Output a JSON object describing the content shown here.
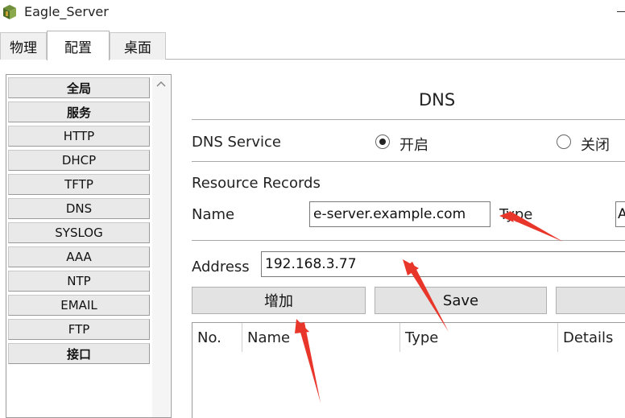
{
  "window": {
    "title": "Eagle_Server"
  },
  "tabs": [
    {
      "label": "物理"
    },
    {
      "label": "配置"
    },
    {
      "label": "桌面"
    }
  ],
  "active_tab": "配置",
  "sidebar": {
    "items": [
      {
        "label": "全局"
      },
      {
        "label": "服务"
      },
      {
        "label": "HTTP"
      },
      {
        "label": "DHCP"
      },
      {
        "label": "TFTP"
      },
      {
        "label": "DNS"
      },
      {
        "label": "SYSLOG"
      },
      {
        "label": "AAA"
      },
      {
        "label": "NTP"
      },
      {
        "label": "EMAIL"
      },
      {
        "label": "FTP"
      },
      {
        "label": "接口"
      }
    ]
  },
  "dns": {
    "title": "DNS",
    "service_label": "DNS Service",
    "on_label": "开启",
    "off_label": "关闭",
    "service_state": "on",
    "records_label": "Resource Records",
    "name_label": "Name",
    "name_value": "e-server.example.com",
    "type_label": "Type",
    "type_value_partial": "A",
    "address_label": "Address",
    "address_value": "192.168.3.77",
    "buttons": {
      "add": "增加",
      "save": "Save"
    },
    "table_headers": [
      "No.",
      "Name",
      "Type",
      "Details"
    ]
  },
  "colors": {
    "annotation_arrow": "#e8362a",
    "nav_bg": "#e9e9e9",
    "button_bg": "#e3e3e3"
  }
}
